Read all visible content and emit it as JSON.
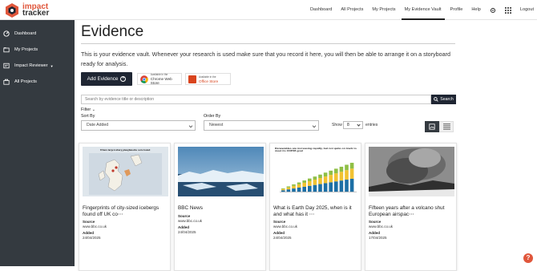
{
  "brand": {
    "line1": "impact",
    "line2": "tracker",
    "accent": "#e0563b",
    "dark": "#1f2633"
  },
  "nav": {
    "items": [
      "Dashboard",
      "All Projects",
      "My Projects",
      "My Evidence Vault",
      "Profile",
      "Help"
    ],
    "active": "My Evidence Vault",
    "icons": [
      "gear-icon",
      "apps-grid-icon"
    ],
    "logout": "Logout"
  },
  "sidebar": {
    "items": [
      {
        "label": "Dashboard",
        "icon": "dashboard-icon"
      },
      {
        "label": "My Projects",
        "icon": "folder-icon"
      },
      {
        "label": "Impact Reviewer",
        "icon": "review-icon",
        "dropdown": true
      },
      {
        "label": "All Projects",
        "icon": "projects-icon"
      }
    ]
  },
  "page": {
    "title": "Evidence",
    "intro": "This is your evidence vault. Whenever your research is used make sure that you record it here, you will then be able to arrange it on a storyboard ready for analysis.",
    "add_button": "Add Evidence",
    "chrome_store": {
      "small": "Available in the",
      "name": "Chrome Web Store"
    },
    "office_store": {
      "small": "Available in the",
      "name": "Office Store"
    }
  },
  "search": {
    "placeholder": "Search by evidence title or description",
    "button": "Search"
  },
  "filters": {
    "filter_label": "Filter",
    "sort_label": "Sort By",
    "sort_value": "Date Added",
    "order_label": "Order By",
    "order_value": "Newest",
    "show_label": "Show",
    "show_value": "8",
    "entries_label": "entries"
  },
  "cards": [
    {
      "title": "Fingerprints of city-sized icebergs found off UK co⋯",
      "source_label": "Source",
      "source": "www.bbc.co.uk",
      "added_label": "Added",
      "added": "24/04/2025",
      "thumb_title": "Where large iceberg ploughmarks were found"
    },
    {
      "title": "BBC News",
      "source_label": "Source",
      "source": "www.bbc.co.uk",
      "added_label": "Added",
      "added": "24/04/2025"
    },
    {
      "title": "What is Earth Day 2025, when is it and what has it ⋯",
      "source_label": "Source",
      "source": "www.bbc.co.uk",
      "added_label": "Added",
      "added": "24/04/2025",
      "thumb_title": "Renewables are increasing rapidly, but not quite on track to meet its COP28 goal"
    },
    {
      "title": "Fifteen years after a volcano shut European airspac⋯",
      "source_label": "Source",
      "source": "www.bbc.co.uk",
      "added_label": "Added",
      "added": "17/04/2025"
    }
  ],
  "help": "?"
}
